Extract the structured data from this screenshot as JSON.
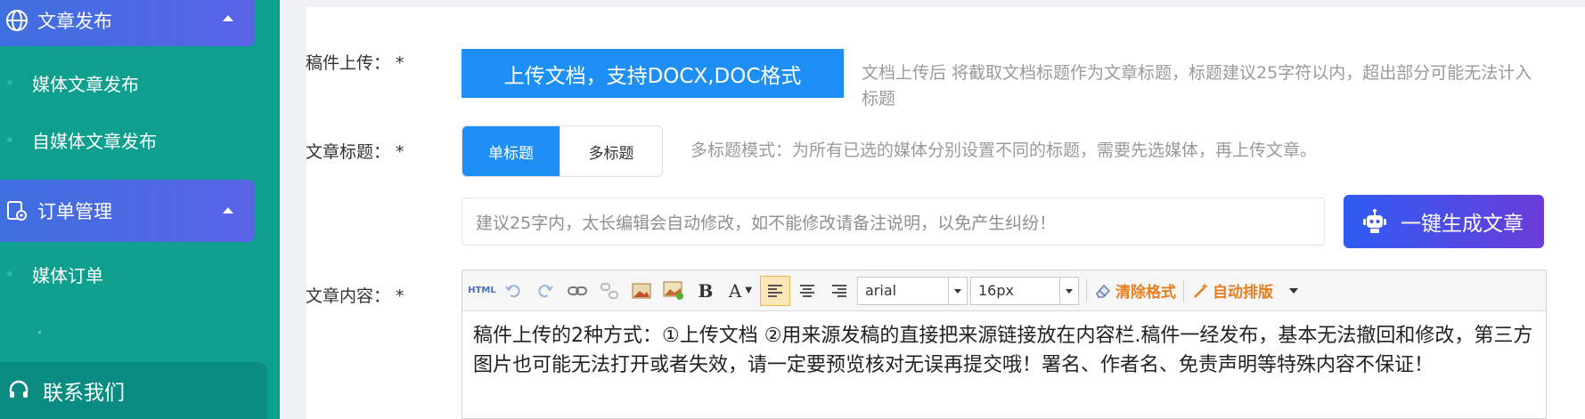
{
  "sidebar": {
    "menus": [
      {
        "title": "文章发布",
        "icon": "globe-icon",
        "items": [
          "媒体文章发布",
          "自媒体文章发布"
        ]
      },
      {
        "title": "订单管理",
        "icon": "order-settings-icon",
        "items": [
          "媒体订单"
        ]
      }
    ],
    "contact": {
      "label": "联系我们",
      "icon": "headset-icon"
    }
  },
  "form": {
    "upload": {
      "label": "稿件上传：",
      "required": "*",
      "button": "上传文档，支持DOCX,DOC格式",
      "hint": "文档上传后 将截取文档标题作为文章标题，标题建议25字符以内，超出部分可能无法计入标题"
    },
    "title": {
      "label": "文章标题：",
      "required": "*",
      "single": "单标题",
      "multi": "多标题",
      "hint": "多标题模式：为所有已选的媒体分别设置不同的标题，需要先选媒体，再上传文章。",
      "placeholder": "建议25字内，太长编辑会自动修改，如不能修改请备注说明，以免产生纠纷！",
      "generate_button": "一键生成文章"
    },
    "content": {
      "label": "文章内容：",
      "required": "*",
      "toolbar": {
        "html": "HTML",
        "font_family": "arial",
        "font_size": "16px",
        "clear_format": "清除格式",
        "auto_layout": "自动排版"
      },
      "text": "稿件上传的2种方式：①上传文档 ②用来源发稿的直接把来源链接放在内容栏.稿件一经发布，基本无法撤回和修改，第三方图片也可能无法打开或者失效，请一定要预览核对无误再提交哦！署名、作者名、免责声明等特殊内容不保证！"
    }
  },
  "colors": {
    "sidebar": "#0e9f8f",
    "accent": "#1e90f5",
    "menu_head": "#4a68e3",
    "gen_button": "#2f5cf3"
  }
}
